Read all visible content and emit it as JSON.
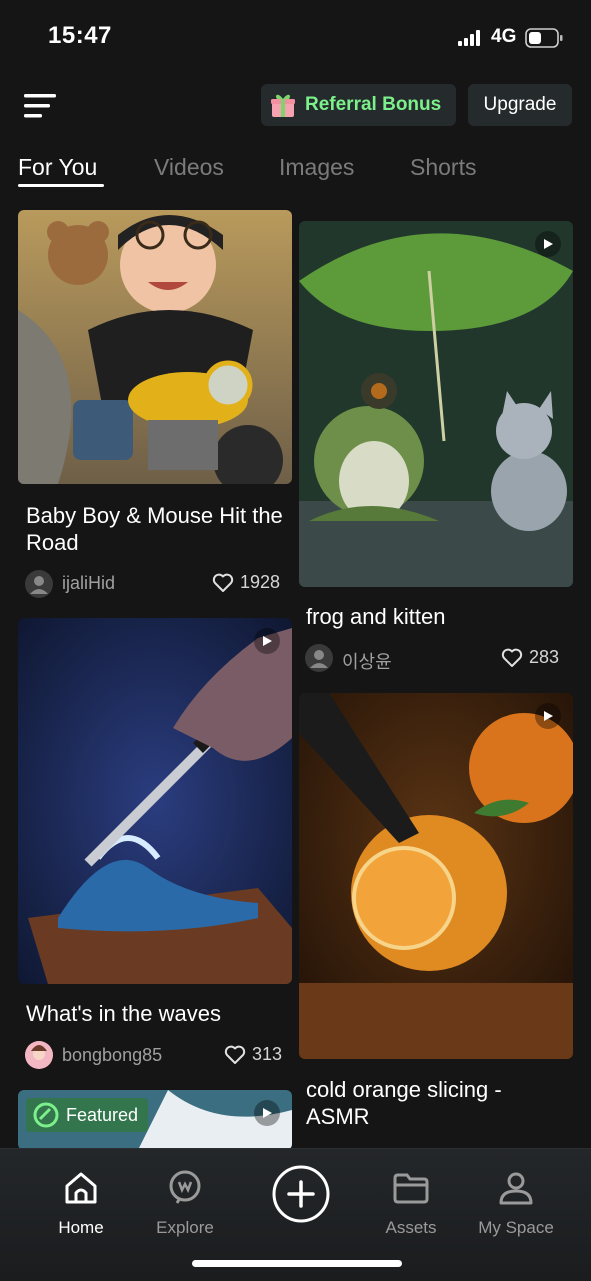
{
  "status_bar": {
    "time": "15:47",
    "network": "4G"
  },
  "header": {
    "referral_label": "Referral Bonus",
    "upgrade_label": "Upgrade"
  },
  "tabs": [
    {
      "label": "For You",
      "active": true
    },
    {
      "label": "Videos",
      "active": false
    },
    {
      "label": "Images",
      "active": false
    },
    {
      "label": "Shorts",
      "active": false
    }
  ],
  "feed": {
    "left": [
      {
        "title": "Baby Boy & Mouse Hit the Road",
        "author": "ijaliHid",
        "likes": "1928",
        "video": false
      },
      {
        "title": "What's in the waves",
        "author": "bongbong85",
        "likes": "313",
        "video": true
      },
      {
        "badge": "Featured",
        "video": true
      }
    ],
    "right": [
      {
        "title": "frog and kitten",
        "author": "이상윤",
        "likes": "283",
        "video": true
      },
      {
        "title": "cold orange slicing - ASMR",
        "video": true
      }
    ]
  },
  "bottom_nav": [
    {
      "label": "Home",
      "icon": "home-icon",
      "active": true
    },
    {
      "label": "Explore",
      "icon": "explore-icon",
      "active": false
    },
    {
      "label": "",
      "icon": "create-plus-icon",
      "active": false
    },
    {
      "label": "Assets",
      "icon": "folder-icon",
      "active": false
    },
    {
      "label": "My Space",
      "icon": "user-icon",
      "active": false
    }
  ],
  "colors": {
    "background": "#151515",
    "accent_green": "#7cf08a",
    "pill_bg": "#252a2d"
  }
}
